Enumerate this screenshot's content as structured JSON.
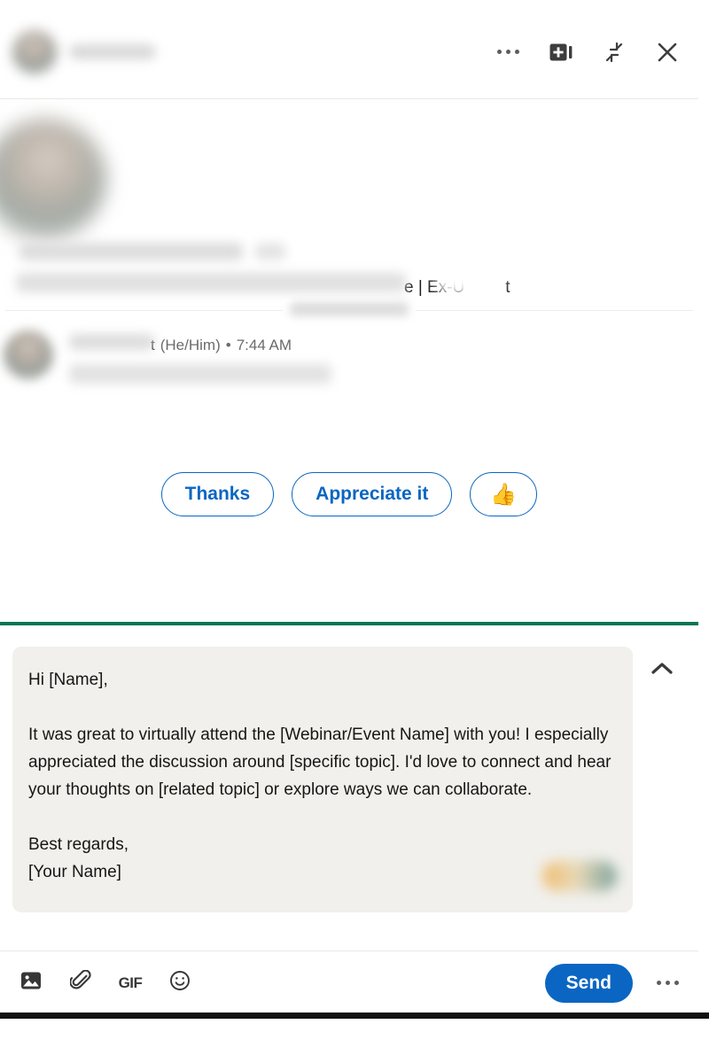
{
  "header": {
    "participant_name_redacted": true,
    "actions": [
      {
        "name": "more-options",
        "icon": "ellipsis-icon",
        "label": "More"
      },
      {
        "name": "video-meeting",
        "icon": "video-add-icon",
        "label": "Create video meeting"
      },
      {
        "name": "minimize",
        "icon": "collapse-diagonal-icon",
        "label": "Minimize"
      },
      {
        "name": "close",
        "icon": "close-icon",
        "label": "Close"
      }
    ]
  },
  "profile": {
    "name_redacted": true,
    "headline_visible_fragment": "e | Ex-U",
    "headline_visible_tail": "t"
  },
  "date_separator": {
    "label_redacted": true
  },
  "message": {
    "sender_visible_tail": "t",
    "pronouns": "(He/Him)",
    "separator": "•",
    "timestamp": "7:44 AM",
    "body_redacted": true
  },
  "quick_replies": [
    {
      "name": "quick-reply-thanks",
      "label": "Thanks"
    },
    {
      "name": "quick-reply-appreciate-it",
      "label": "Appreciate it"
    },
    {
      "name": "quick-reply-thumbs-up",
      "label": "👍"
    }
  ],
  "composer": {
    "collapse_label": "Collapse",
    "draft_text": "Hi [Name],\n\nIt was great to virtually attend the [Webinar/Event Name] with you! I especially appreciated the discussion around [specific topic]. I'd love to connect and hear your thoughts on [related topic] or explore ways we can collaborate.\n\nBest regards,\n[Your Name]",
    "toolbar": {
      "image_label": "Add a photo",
      "attach_label": "Attach a file",
      "gif_label": "GIF",
      "emoji_label": "Open Emoji Keyboard",
      "send_label": "Send",
      "more_label": "More"
    }
  },
  "colors": {
    "brand_blue": "#0a66c2",
    "accent_green": "#09764f",
    "compose_bg": "#f1f0ec",
    "text_primary": "#161616",
    "text_secondary": "#6b6b6b",
    "border": "#e8e8e8"
  }
}
